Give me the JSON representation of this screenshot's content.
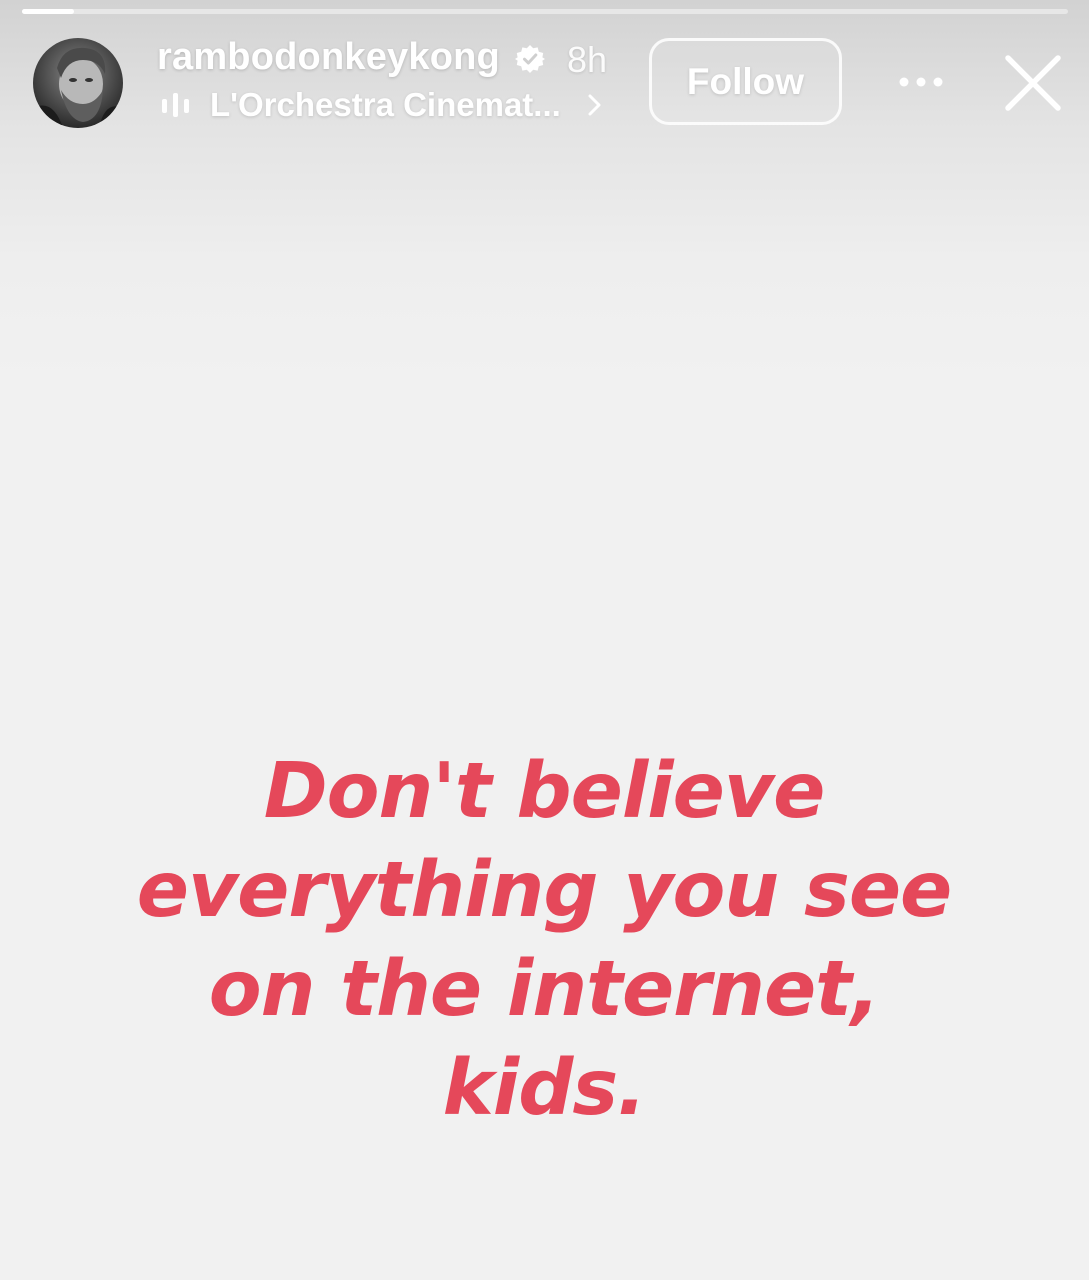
{
  "story": {
    "progress": 0.05,
    "user": {
      "username": "rambodonkeykong",
      "verified": true,
      "time_ago": "8h",
      "avatar_icon": "user-avatar-photo"
    },
    "music": {
      "icon": "audio-bars-icon",
      "label": "L'Orchestra Cinemat..."
    },
    "actions": {
      "follow_label": "Follow",
      "more_icon": "more-options-icon",
      "close_icon": "close-icon"
    },
    "text_lines": [
      "Don't believe",
      "everything you see",
      "on the internet,",
      "kids."
    ],
    "colors": {
      "text": "#e5485a",
      "background": "#f1f1f1",
      "overlay_text": "#ffffff"
    }
  }
}
